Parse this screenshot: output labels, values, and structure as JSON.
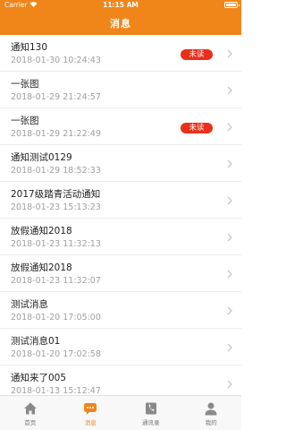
{
  "status": {
    "carrier": "Carrier",
    "time": "11:15 AM"
  },
  "header": {
    "title": "消息"
  },
  "messages": [
    {
      "title": "通知130",
      "time": "2018-01-30 10:24:43",
      "badge": "未读"
    },
    {
      "title": "一张图",
      "time": "2018-01-29 21:24:57",
      "badge": ""
    },
    {
      "title": "一张图",
      "time": "2018-01-29 21:22:49",
      "badge": "未读"
    },
    {
      "title": "通知测试0129",
      "time": "2018-01-29 18:52:33",
      "badge": ""
    },
    {
      "title": "2017级踏青活动通知",
      "time": "2018-01-23 15:13:23",
      "badge": ""
    },
    {
      "title": "放假通知2018",
      "time": "2018-01-23 11:32:13",
      "badge": ""
    },
    {
      "title": "放假通知2018",
      "time": "2018-01-23 11:32:07",
      "badge": ""
    },
    {
      "title": "测试消息",
      "time": "2018-01-20 17:05:00",
      "badge": ""
    },
    {
      "title": "测试消息01",
      "time": "2018-01-20 17:02:58",
      "badge": ""
    },
    {
      "title": "通知来了005",
      "time": "2018-01-13 15:12:47",
      "badge": ""
    }
  ],
  "tabs": [
    {
      "label": "首页",
      "icon": "home-icon",
      "active": false
    },
    {
      "label": "消息",
      "icon": "message-icon",
      "active": true
    },
    {
      "label": "通讯录",
      "icon": "contacts-icon",
      "active": false
    },
    {
      "label": "我的",
      "icon": "profile-icon",
      "active": false
    }
  ],
  "colors": {
    "accent": "#f08519",
    "badge": "#e9301a",
    "tab_inactive": "#8a8a8a"
  }
}
